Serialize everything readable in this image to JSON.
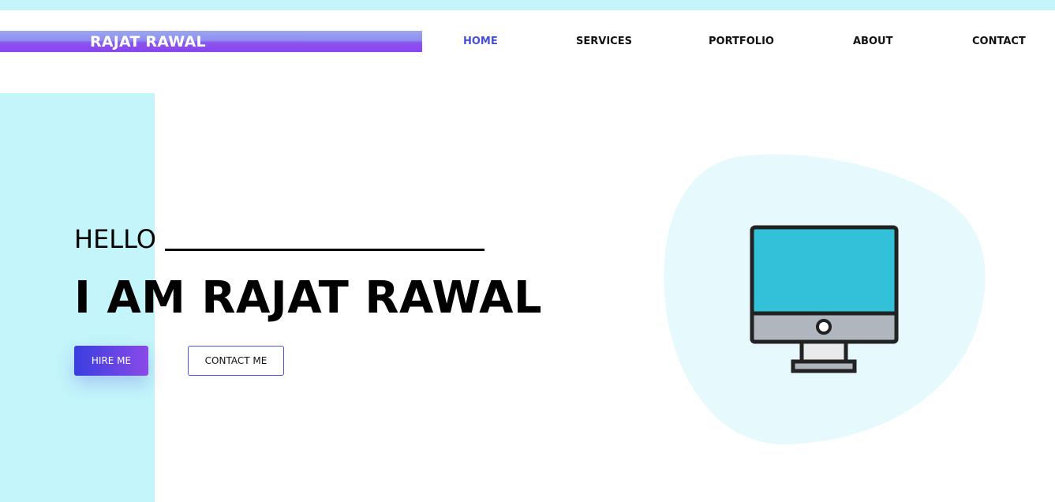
{
  "header": {
    "brand": "RAJAT RAWAL",
    "nav": [
      {
        "label": "HOME",
        "active": true
      },
      {
        "label": "SERVICES",
        "active": false
      },
      {
        "label": "PORTFOLIO",
        "active": false
      },
      {
        "label": "ABOUT",
        "active": false
      },
      {
        "label": "CONTACT",
        "active": false
      }
    ]
  },
  "hero": {
    "greeting": "HELLO",
    "headline": "I AM RAJAT RAWAL",
    "buttons": {
      "hire": "HIRE ME",
      "contact": "CONTACT ME"
    },
    "illustration": "desktop-monitor-icon"
  },
  "colors": {
    "accent": "#4650d8",
    "panel": "#c3f5fb",
    "blob": "#e6fafd",
    "gradient_start": "#3a3ee0",
    "gradient_end": "#8a4ae8",
    "screen": "#32c1d9"
  }
}
